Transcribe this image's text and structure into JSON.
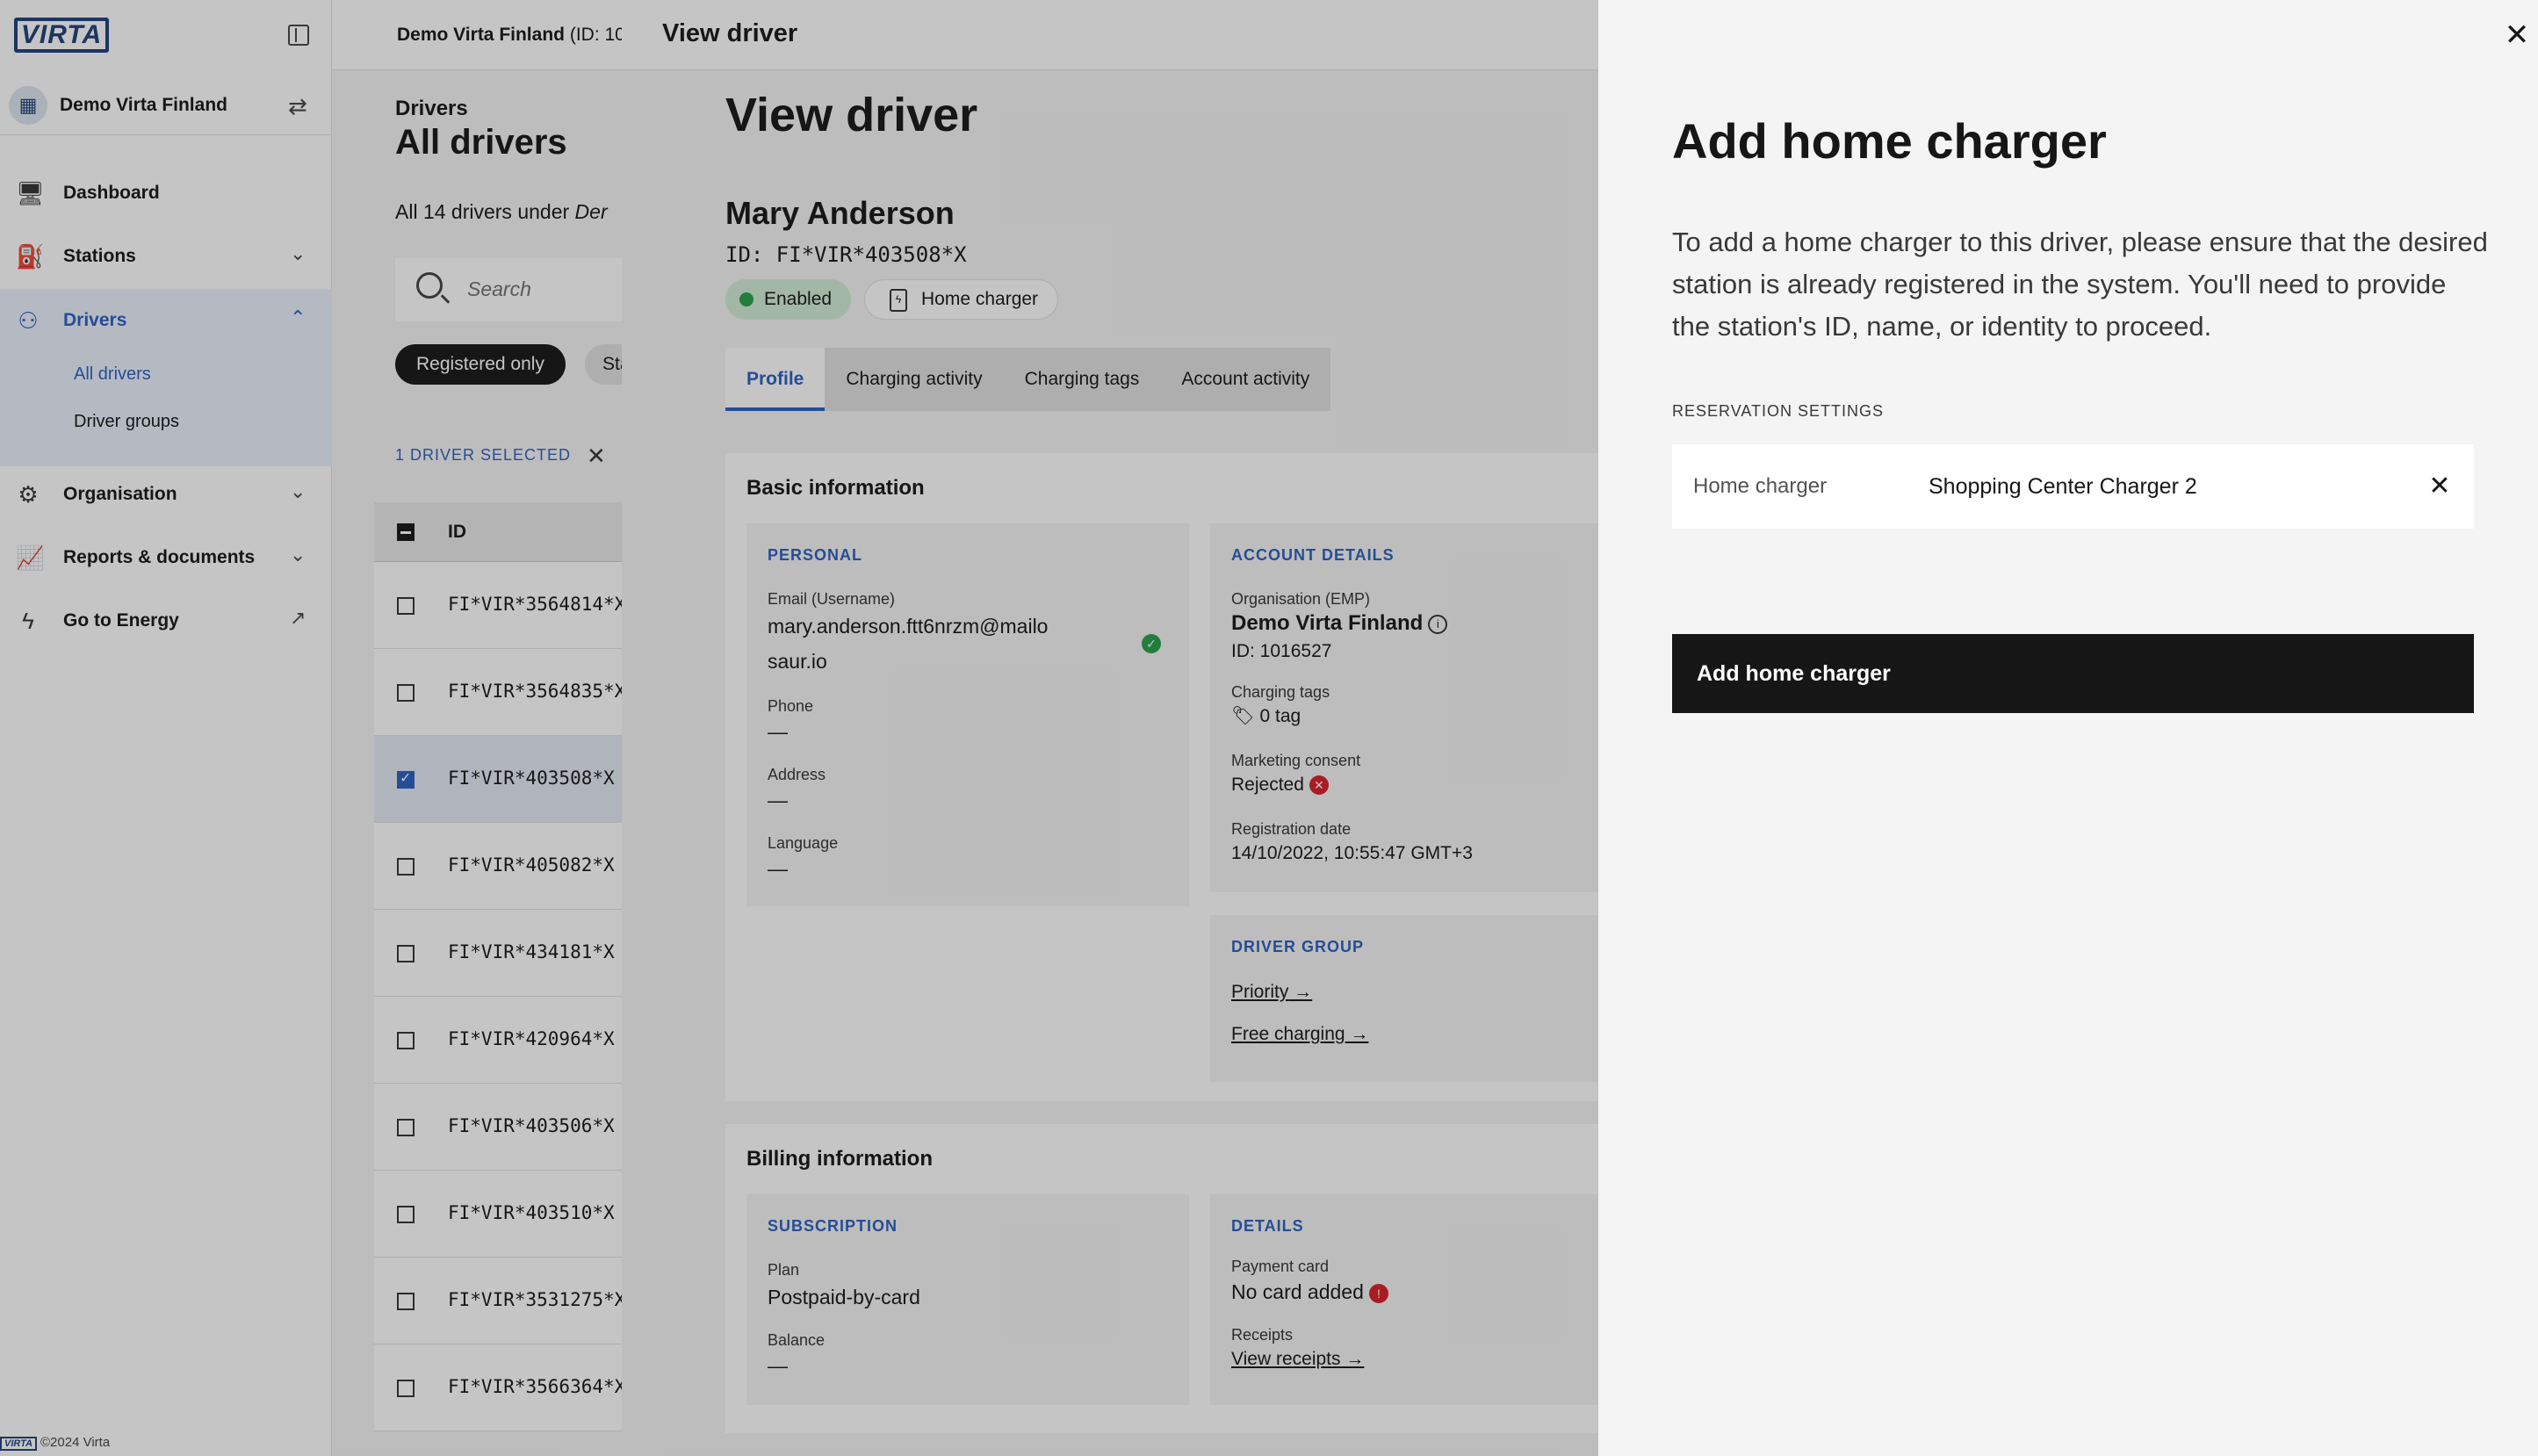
{
  "sidebar": {
    "logo_text": "VIRTA",
    "org_name": "Demo Virta Finland",
    "nav": [
      {
        "label": "Dashboard"
      },
      {
        "label": "Stations"
      },
      {
        "label": "Drivers"
      },
      {
        "label": "Organisation"
      },
      {
        "label": "Reports & documents"
      },
      {
        "label": "Go to Energy"
      }
    ],
    "drivers_sub": [
      "All drivers",
      "Driver groups"
    ],
    "footer_logo": "VIRTA",
    "footer": "©2024 Virta"
  },
  "drivers_page": {
    "topbar_org": "Demo Virta Finland",
    "topbar_id": "(ID: 10",
    "eyebrow": "Drivers",
    "title": "All drivers",
    "count_text": "All 14 drivers under",
    "count_org": "Der",
    "search_placeholder": "Search",
    "filter_registered": "Registered only",
    "filter_status": "Sta",
    "selected_text": "1 DRIVER SELECTED",
    "column_id": "ID",
    "rows": [
      {
        "id": "FI*VIR*3564814*X",
        "selected": false
      },
      {
        "id": "FI*VIR*3564835*X",
        "selected": false
      },
      {
        "id": "FI*VIR*403508*X",
        "selected": true
      },
      {
        "id": "FI*VIR*405082*X",
        "selected": false
      },
      {
        "id": "FI*VIR*434181*X",
        "selected": false
      },
      {
        "id": "FI*VIR*420964*X",
        "selected": false
      },
      {
        "id": "FI*VIR*403506*X",
        "selected": false
      },
      {
        "id": "FI*VIR*403510*X",
        "selected": false
      },
      {
        "id": "FI*VIR*3531275*X",
        "selected": false
      },
      {
        "id": "FI*VIR*3566364*X",
        "selected": false
      }
    ]
  },
  "view_driver": {
    "topbar_title": "View driver",
    "title": "View driver",
    "name": "Mary Anderson",
    "id_line": "ID: FI*VIR*403508*X",
    "status_badge": "Enabled",
    "home_badge": "Home charger",
    "tabs": [
      "Profile",
      "Charging activity",
      "Charging tags",
      "Account activity"
    ],
    "basic_title": "Basic information",
    "personal": {
      "heading": "PERSONAL",
      "email_label": "Email (Username)",
      "email_line1": "mary.anderson.ftt6nrzm@mailo",
      "email_line2": "saur.io",
      "phone_label": "Phone",
      "phone_value": "—",
      "address_label": "Address",
      "address_value": "—",
      "language_label": "Language",
      "language_value": "—"
    },
    "account": {
      "heading": "ACCOUNT DETAILS",
      "org_label": "Organisation (EMP)",
      "org_value": "Demo Virta Finland",
      "org_id": "ID: 1016527",
      "tags_label": "Charging tags",
      "tags_value": "0 tag",
      "marketing_label": "Marketing consent",
      "marketing_value": "Rejected",
      "reg_label": "Registration date",
      "reg_value": "14/10/2022, 10:55:47 GMT+3"
    },
    "driver_group": {
      "heading": "DRIVER GROUP",
      "items": [
        "Priority",
        "Free charging"
      ]
    },
    "billing_title": "Billing information",
    "subscription": {
      "heading": "SUBSCRIPTION",
      "plan_label": "Plan",
      "plan_value": "Postpaid-by-card",
      "balance_label": "Balance",
      "balance_value": "—"
    },
    "details": {
      "heading": "DETAILS",
      "card_label": "Payment card",
      "card_value": "No card added",
      "receipts_label": "Receipts",
      "receipts_link": "View receipts"
    }
  },
  "drawer": {
    "title": "Add home charger",
    "description": "To add a home charger to this driver, please ensure that the desired station is already registered in the system. You'll need to provide the station's ID, name, or identity to proceed.",
    "section_label": "RESERVATION SETTINGS",
    "field_label": "Home charger",
    "field_value": "Shopping Center Charger 2",
    "submit_label": "Add home charger"
  }
}
